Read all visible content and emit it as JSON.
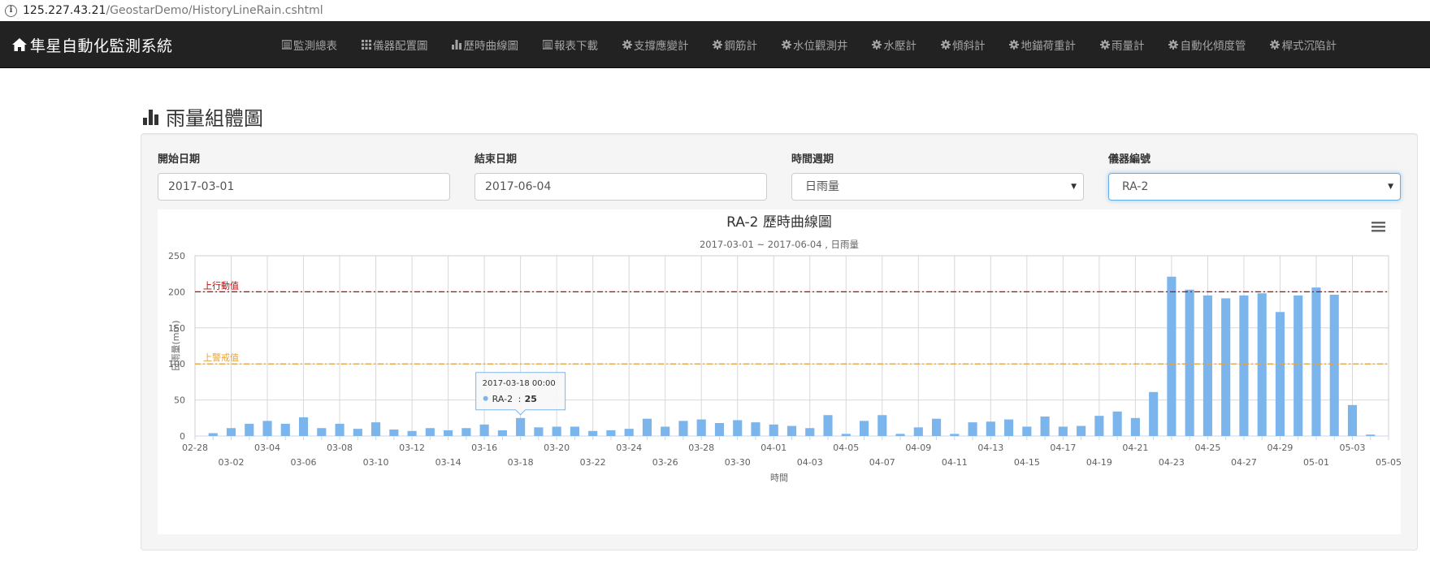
{
  "address": {
    "host": "125.227.43.21",
    "path": "/GeostarDemo/HistoryLineRain.cshtml"
  },
  "navbar": {
    "brand": "隼星自動化監測系統",
    "items": [
      {
        "label": "監測總表",
        "icon": "list-icon"
      },
      {
        "label": "儀器配置圖",
        "icon": "grid-icon"
      },
      {
        "label": "歷時曲線圖",
        "icon": "bar-chart-icon"
      },
      {
        "label": "報表下載",
        "icon": "list-icon"
      },
      {
        "label": "支撐應變計",
        "icon": "gear-icon"
      },
      {
        "label": "鋼筋計",
        "icon": "gear-icon"
      },
      {
        "label": "水位觀測井",
        "icon": "gear-icon"
      },
      {
        "label": "水壓計",
        "icon": "gear-icon"
      },
      {
        "label": "傾斜計",
        "icon": "gear-icon"
      },
      {
        "label": "地錨荷重計",
        "icon": "gear-icon"
      },
      {
        "label": "雨量計",
        "icon": "gear-icon"
      },
      {
        "label": "自動化傾度管",
        "icon": "gear-icon"
      },
      {
        "label": "桿式沉陷計",
        "icon": "gear-icon"
      }
    ]
  },
  "page": {
    "title": "雨量組體圖"
  },
  "form": {
    "start_label": "開始日期",
    "start_value": "2017-03-01",
    "end_label": "結束日期",
    "end_value": "2017-06-04",
    "period_label": "時間週期",
    "period_value": "日雨量",
    "instrument_label": "儀器編號",
    "instrument_value": "RA-2"
  },
  "tooltip": {
    "date": "2017-03-18 00:00",
    "series": "RA-2",
    "value": "25"
  },
  "colors": {
    "bar": "#7cb5ec",
    "action_line": "#cc0000",
    "alert_line": "#e8a33c",
    "navbar": "#222222"
  },
  "chart_data": {
    "type": "bar",
    "title": "RA-2 歷時曲線圖",
    "subtitle": "2017-03-01 ~ 2017-06-04 , 日雨量",
    "xlabel": "時間",
    "ylabel": "日雨量(mm)",
    "ylim": [
      0,
      250
    ],
    "yticks": [
      0,
      50,
      100,
      150,
      200,
      250
    ],
    "xlim": [
      "2017-02-28",
      "2017-05-05"
    ],
    "xticks_upper": [
      "02-28",
      "03-04",
      "03-08",
      "03-12",
      "03-16",
      "03-20",
      "03-24",
      "03-28",
      "04-01",
      "04-05",
      "04-09",
      "04-13",
      "04-17",
      "04-21",
      "04-25",
      "04-29",
      "05-03"
    ],
    "xticks_lower": [
      "03-02",
      "03-06",
      "03-10",
      "03-14",
      "03-18",
      "03-22",
      "03-26",
      "03-30",
      "04-03",
      "04-07",
      "04-11",
      "04-15",
      "04-19",
      "04-23",
      "04-27",
      "05-01",
      "05-05"
    ],
    "grid": true,
    "plot_lines": [
      {
        "label": "上行動值",
        "value": 200,
        "color": "#cc0000"
      },
      {
        "label": "上警戒值",
        "value": 100,
        "color": "#e8a33c"
      }
    ],
    "series": [
      {
        "name": "RA-2",
        "start_date": "2017-03-01",
        "values": [
          4,
          11,
          17,
          21,
          17,
          26,
          11,
          17,
          10,
          19,
          9,
          7,
          11,
          8,
          11,
          16,
          8,
          25,
          12,
          13,
          13,
          7,
          8,
          10,
          24,
          13,
          21,
          23,
          18,
          22,
          19,
          16,
          14,
          11,
          29,
          3,
          21,
          29,
          3,
          12,
          24,
          3,
          19,
          20,
          23,
          13,
          27,
          13,
          14,
          28,
          34,
          25,
          61,
          221,
          203,
          195,
          191,
          195,
          198,
          172,
          195,
          206,
          196,
          43,
          2
        ]
      }
    ]
  }
}
